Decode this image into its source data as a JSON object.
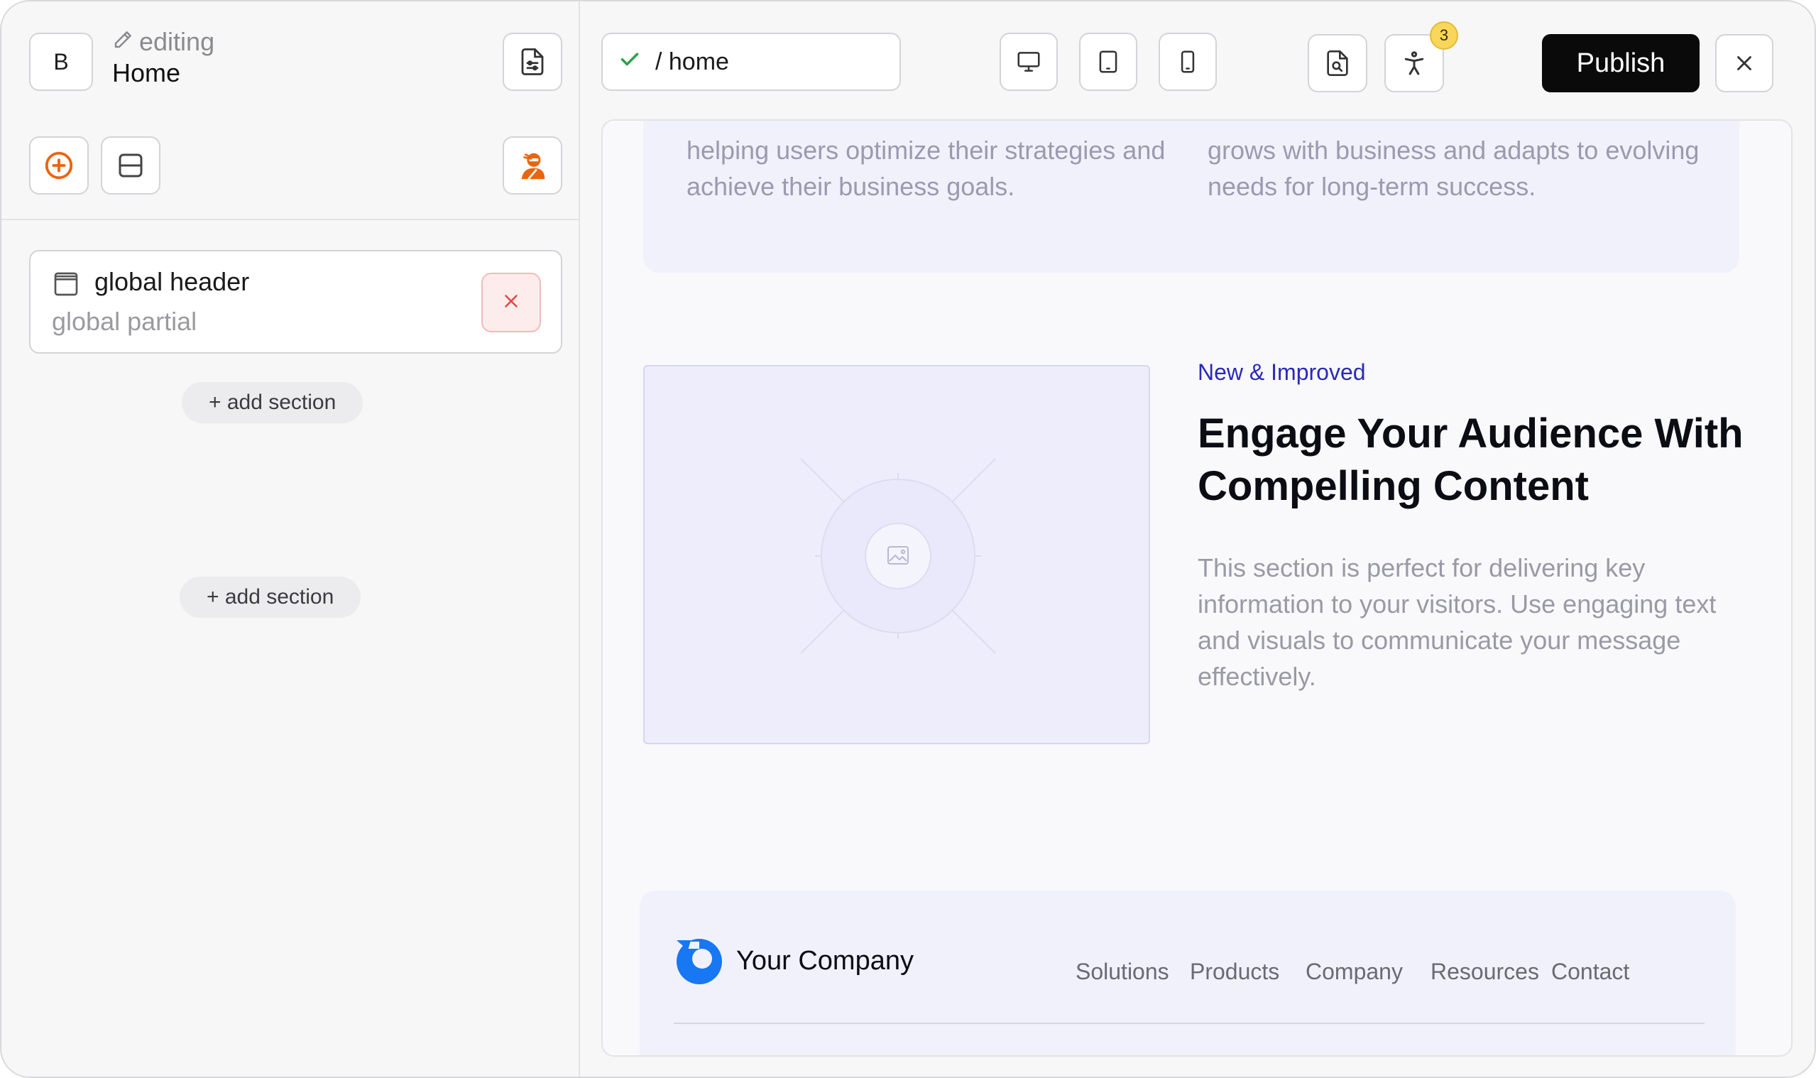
{
  "sidebar": {
    "avatar_initial": "B",
    "editing_label": "editing",
    "page_name": "Home",
    "sections": [
      {
        "title": "global header",
        "subtitle": "global partial"
      }
    ],
    "add_section_label": "+ add section"
  },
  "toolbar": {
    "url_path": "/ home",
    "accessibility_issue_count": "3",
    "publish_label": "Publish"
  },
  "canvas": {
    "feature_left_text": "helping users optimize their strategies and achieve their business goals.",
    "feature_right_text": "grows with business and adapts to evolving needs for long-term success.",
    "eyebrow": "New & Improved",
    "headline": "Engage Your Audience With Compelling Content",
    "body": "This section is perfect for delivering key information to your visitors. Use engaging text and visuals to communicate your message effectively.",
    "footer": {
      "company_name": "Your Company",
      "nav": [
        "Solutions",
        "Products",
        "Company",
        "Resources",
        "Contact"
      ]
    }
  },
  "colors": {
    "accent_orange": "#e8650f",
    "success_green": "#2aa34a",
    "danger_red": "#e0483e",
    "brand_blue": "#1877f2",
    "eyebrow_blue": "#2a2ab8"
  },
  "icons": {
    "page_settings": "document-settings-icon",
    "add": "plus-circle-icon",
    "layout": "layout-split-icon",
    "ai_assistant": "ninja-avatar-icon",
    "section": "header-section-icon",
    "remove": "close-icon",
    "url_status": "check-icon",
    "desktop": "desktop-icon",
    "tablet": "tablet-icon",
    "mobile": "mobile-icon",
    "seo": "seo-search-icon",
    "accessibility": "accessibility-icon",
    "close": "close-icon"
  }
}
